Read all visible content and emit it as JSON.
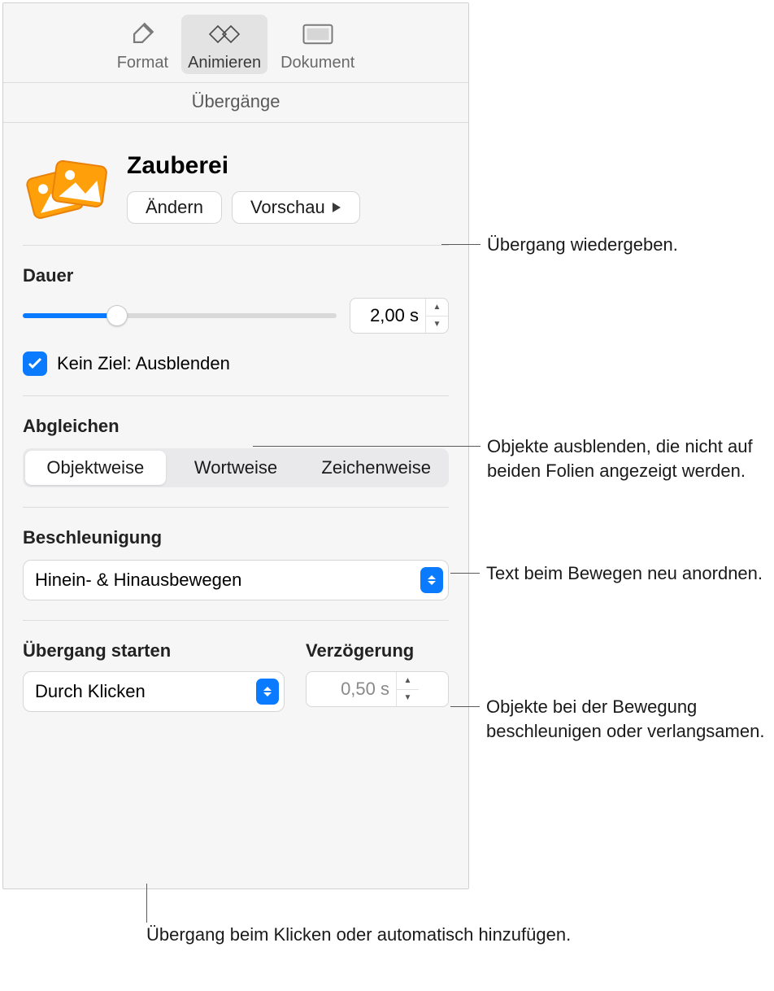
{
  "toolbar": {
    "format": "Format",
    "animate": "Animieren",
    "document": "Dokument"
  },
  "subheader": "Übergänge",
  "title": "Zauberei",
  "buttons": {
    "change": "Ändern",
    "preview": "Vorschau"
  },
  "duration": {
    "label": "Dauer",
    "value": "2,00 s",
    "percent": 30
  },
  "fade_unmatched": {
    "label": "Kein Ziel: Ausblenden",
    "checked": true
  },
  "match": {
    "label": "Abgleichen",
    "options": [
      "Objektweise",
      "Wortweise",
      "Zeichenweise"
    ],
    "selected": 0
  },
  "accel": {
    "label": "Beschleunigung",
    "value": "Hinein- & Hinausbewegen"
  },
  "start": {
    "label": "Übergang starten",
    "value": "Durch Klicken"
  },
  "delay": {
    "label": "Verzögerung",
    "value": "0,50 s"
  },
  "callouts": {
    "preview": "Übergang wiedergeben.",
    "fade": "Objekte ausblenden, die nicht auf beiden Folien angezeigt werden.",
    "match": "Text beim Bewegen neu anordnen.",
    "accel": "Objekte bei der Bewegung beschleunigen oder verlangsamen.",
    "start": "Übergang beim Klicken oder automatisch hinzufügen."
  }
}
